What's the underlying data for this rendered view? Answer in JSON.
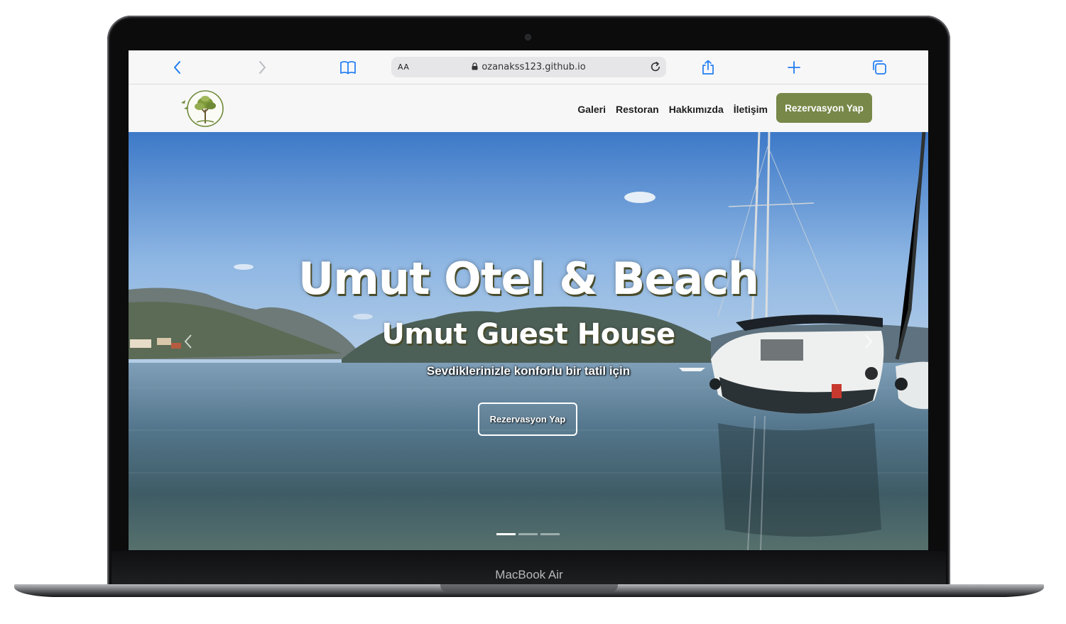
{
  "device": {
    "brand": "MacBook Air"
  },
  "browser": {
    "aa_label": "AA",
    "url": "ozanakss123.github.io",
    "icons": [
      "back-icon",
      "forward-icon",
      "bookmarks-icon",
      "lock-icon",
      "reload-icon",
      "share-icon",
      "new-tab-icon",
      "tabs-icon"
    ]
  },
  "nav": {
    "logo": "olive-tree-logo",
    "items": [
      "Galeri",
      "Restoran",
      "Hakkımızda",
      "İletişim"
    ],
    "cta": "Rezervasyon Yap",
    "cta_color": "#788848"
  },
  "hero": {
    "title": "Umut Otel & Beach",
    "subtitle": "Umut Guest House",
    "tagline": "Sevdiklerinizle konforlu bir tatil için",
    "button": "Rezervasyon Yap",
    "slides": 3,
    "active_slide": 1
  }
}
